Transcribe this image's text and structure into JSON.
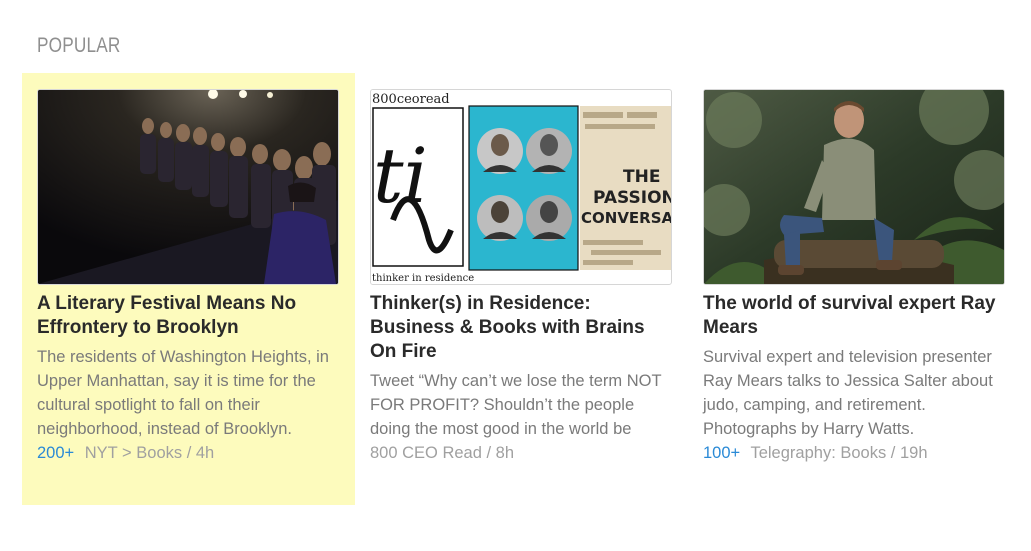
{
  "section": {
    "title": "POPULAR"
  },
  "colors": {
    "highlight": "#fdfbbd",
    "count": "#2a8ad6",
    "headline": "#2a2a2a",
    "summary": "#7a7a7a"
  },
  "cards": [
    {
      "headline": "A Literary Festival Means No Effrontery to Brooklyn",
      "summary": "The residents of Washington Heights, in Upper Manhattan, say it is time for the cultural spotlight to fall on their neighborhood, instead of Brooklyn.",
      "count": "200+",
      "source": "NYT > Books / 4h",
      "image": "photo of people seated on a stage under spotlights"
    },
    {
      "headline": "Thinker(s) in Residence: Business & Books with Brains On Fire",
      "summary": "Tweet “Why can’t we lose the term NOT FOR PROFIT? Shouldn’t the people doing the most good in the world be wildly profitable?” Q: What is",
      "count": "",
      "source": "800 CEO Read / 8h",
      "image": {
        "logo_text": "800ceoread",
        "cover_text": "thinker in residence",
        "book_text": "THE PASSION CONVERSATION"
      }
    },
    {
      "headline": "The world of survival expert Ray Mears",
      "summary": "Survival expert and television presenter Ray Mears talks to Jessica Salter about judo, camping, and retirement. Photographs by Harry Watts.",
      "count": "100+",
      "source": "Telegraphy: Books / 19h",
      "image": "photo of a man seated on a log in a forest"
    }
  ]
}
